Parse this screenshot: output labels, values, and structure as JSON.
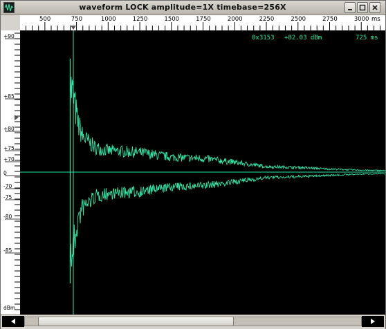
{
  "window": {
    "title": "waveform  LOCK amplitude=1X timebase=256X",
    "app_icon": "waveform-app-icon",
    "controls": [
      "minimize-icon",
      "maximize-icon",
      "close-icon"
    ]
  },
  "readout": {
    "address": "0x3153",
    "level": "+82.03 dBm",
    "time": "725 ms"
  },
  "time_ruler": {
    "unit": "ms",
    "labels": [
      "500",
      "750",
      "1000",
      "1250",
      "1500",
      "1750",
      "2000",
      "2250",
      "2500",
      "2750",
      "3000"
    ],
    "cursor_ms": 725
  },
  "level_ruler": {
    "unit": "dBm",
    "labels": [
      "+90",
      "+85",
      "+80",
      "+75",
      "+70",
      "0",
      "-70",
      "-75",
      "-80",
      "-85"
    ]
  },
  "colors": {
    "trace": "#2ee6a6",
    "cursor": "#2ee6a6",
    "plot_bg": "#000000",
    "readout": "#27f0a0"
  },
  "chart_data": {
    "type": "line",
    "title": "",
    "xlabel": "ms",
    "ylabel": "dBm",
    "x_ticks": [
      500,
      750,
      1000,
      1250,
      1500,
      1750,
      2000,
      2250,
      2500,
      2750,
      3000
    ],
    "xlim": [
      304,
      3190
    ],
    "cursor_x_ms": 725,
    "description_series": [
      {
        "name": "",
        "x_ms": [
          700,
          725,
          760,
          800,
          900,
          1000,
          1250,
          1500,
          1750,
          2000,
          2250,
          2500,
          2750,
          3000,
          3190
        ],
        "peak_dbm": [
          91.5,
          88.5,
          81.5,
          78.0,
          75.2,
          74.5,
          74.0,
          72.8,
          72.5,
          71.5,
          70.4,
          70.2,
          69.8,
          69.5,
          69.4
        ]
      }
    ]
  },
  "scrollbar": {
    "left_arrow": "arrow-left-icon",
    "right_arrow": "arrow-right-icon",
    "thumb_start_fraction": 0.0,
    "thumb_end_fraction": 0.62
  }
}
